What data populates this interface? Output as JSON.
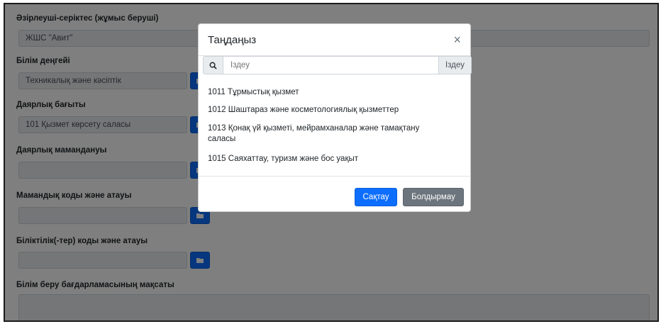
{
  "form": {
    "partner_label": "Әзірлеуші-серіктес (жұмыс беруші)",
    "partner_value": "ЖШС \"Авит\"",
    "education_level_label": "Білім деңгейі",
    "education_level_value": "Техникалық және кәсіптік",
    "training_direction_label": "Даярлық бағыты",
    "training_direction_value": "101 Қызмет көрсету саласы",
    "training_specialty_label": "Даярлық мамандануы",
    "training_specialty_value": "",
    "specialty_code_label": "Мамандық коды және атауы",
    "specialty_code_value": "",
    "qualification_label": "Біліктілік(-тер) коды және атауы",
    "qualification_value": "",
    "program_goal_label": "Білім беру бағдарламасының мақсаты",
    "program_goal_value": ""
  },
  "modal": {
    "title": "Таңдаңыз",
    "close_symbol": "×",
    "search_placeholder": "Іздеу",
    "search_button": "Іздеу",
    "items": [
      "1011 Тұрмыстық қызмет",
      "1012 Шаштараз және косметологиялық қызметтер",
      "1013 Қонақ үй қызметі, мейрамханалар және тамақтану саласы",
      "1015 Саяхаттау, туризм және бос уақыт"
    ],
    "save_button": "Сақтау",
    "cancel_button": "Болдырмау"
  },
  "icons": {
    "search": "search-icon",
    "select": "folder-icon"
  },
  "colors": {
    "primary": "#0d6efd",
    "secondary": "#6c757d",
    "overlay": "rgba(0,0,0,0.5)"
  }
}
